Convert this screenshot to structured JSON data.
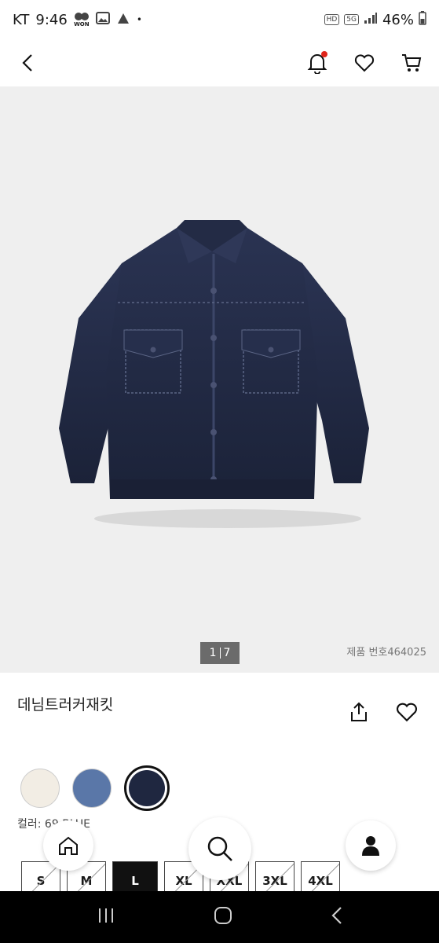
{
  "status_bar": {
    "carrier": "KT",
    "time": "9:46",
    "won_label": "WON",
    "hd_label": "HD",
    "network": "5G",
    "battery": "46%"
  },
  "app_bar": {
    "back_icon": "chevron-left-icon",
    "bell_icon": "bell-icon",
    "heart_icon": "heart-icon",
    "cart_icon": "cart-icon",
    "notification_dot_color": "#e0251b"
  },
  "gallery": {
    "current": "1",
    "total": "7",
    "product_number": "제품 번호464025"
  },
  "product": {
    "name": "데님트러커재킷",
    "color_label": "컬러: 69 BLUE",
    "swatches": [
      {
        "color": "#f2ede4"
      },
      {
        "color": "#5a77a8"
      },
      {
        "color": "#1f2740",
        "selected": true
      }
    ],
    "sizes": [
      {
        "label": "S",
        "available": false
      },
      {
        "label": "M",
        "available": false
      },
      {
        "label": "L",
        "selected": true
      },
      {
        "label": "XL",
        "available": false
      },
      {
        "label": "XXL",
        "available": false
      },
      {
        "label": "3XL",
        "available": false
      },
      {
        "label": "4XL",
        "available": false
      }
    ]
  },
  "floating_nav": {
    "home_icon": "home-icon",
    "search_icon": "search-icon",
    "profile_icon": "profile-icon"
  },
  "system_nav": {
    "recent_icon": "recent-apps-icon",
    "home_icon": "home-circle-icon",
    "back_icon": "back-icon"
  }
}
